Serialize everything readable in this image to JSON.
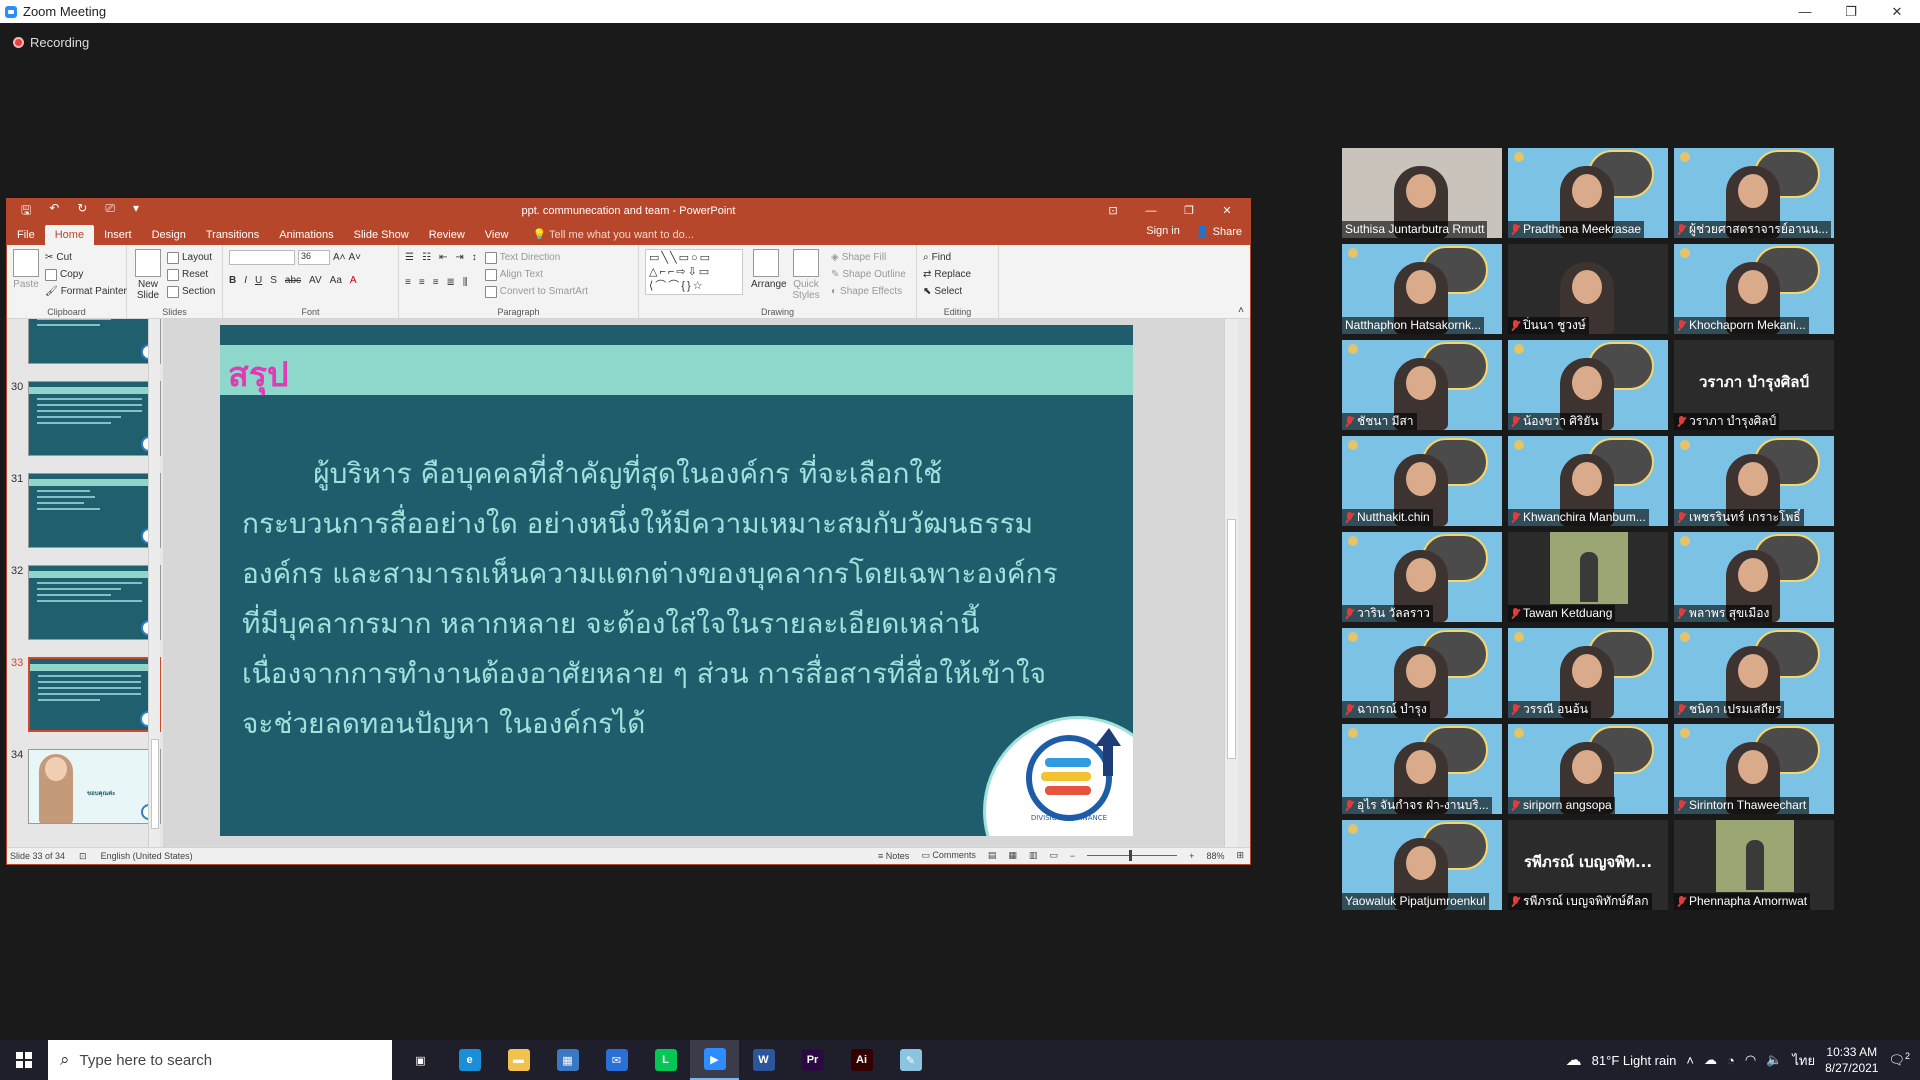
{
  "zoom": {
    "window_title": "Zoom Meeting",
    "recording_label": "Recording",
    "window_controls": [
      "—",
      "❐",
      "✕"
    ]
  },
  "ppt": {
    "doc_title": "ppt. communecation and team - PowerPoint",
    "tabs": [
      "File",
      "Home",
      "Insert",
      "Design",
      "Transitions",
      "Animations",
      "Slide Show",
      "Review",
      "View"
    ],
    "active_tab": "Home",
    "tell_me": "Tell me what you want to do...",
    "sign_in": "Sign in",
    "share": "Share",
    "ribbon": {
      "clipboard": {
        "label": "Clipboard",
        "paste": "Paste",
        "cut": "Cut",
        "copy": "Copy",
        "format_painter": "Format Painter"
      },
      "slides": {
        "label": "Slides",
        "new_slide": "New Slide",
        "layout": "Layout",
        "reset": "Reset",
        "section": "Section"
      },
      "font": {
        "label": "Font",
        "size": "36"
      },
      "paragraph": {
        "label": "Paragraph",
        "text_direction": "Text Direction",
        "align_text": "Align Text",
        "convert_smartart": "Convert to SmartArt"
      },
      "drawing": {
        "label": "Drawing",
        "arrange": "Arrange",
        "quick_styles": "Quick Styles",
        "shape_fill": "Shape Fill",
        "shape_outline": "Shape Outline",
        "shape_effects": "Shape Effects"
      },
      "editing": {
        "label": "Editing",
        "find": "Find",
        "replace": "Replace",
        "select": "Select"
      }
    },
    "thumbnails": [
      {
        "num": "",
        "type": "text"
      },
      {
        "num": "30",
        "type": "text"
      },
      {
        "num": "31",
        "type": "text"
      },
      {
        "num": "32",
        "type": "text"
      },
      {
        "num": "33",
        "type": "text",
        "selected": true
      },
      {
        "num": "34",
        "type": "photo",
        "caption": "ขอบคุณค่ะ"
      }
    ],
    "slide": {
      "title": "สรุป",
      "lines": [
        "        ผู้บริหาร คือบุคคลที่สำคัญที่สุดในองค์กร ที่จะเลือกใช้",
        "กระบวนการสื่ออย่างใด อย่างหนึ่งให้มีความเหมาะสมกับวัฒนธรรม",
        "องค์กร และสามารถเห็นความแตกต่างของบุคลากรโดยเฉพาะองค์กร",
        "ที่มีบุคลากรมาก หลากหลาย จะต้องใส่ใจในรายละเอียดเหล่านี้",
        "เนื่องจากการทำงานต้องอาศัยหลาย ๆ ส่วน การสื่อสารที่สื่อให้เข้าใจ",
        "จะช่วยลดทอนปัญหา ในองค์กรได้"
      ],
      "logo_text": "DIVISION OF FINANCE"
    },
    "status": {
      "slide_of": "Slide 33 of 34",
      "language": "English (United States)",
      "notes": "Notes",
      "comments": "Comments",
      "zoom": "88%"
    }
  },
  "participants": [
    {
      "name": "Suthisa  Juntarbutra Rmutt",
      "muted": false,
      "kind": "speaker"
    },
    {
      "name": "Pradthana Meekrasae",
      "muted": true,
      "kind": "bg"
    },
    {
      "name": "ผู้ช่วยศาสตราจารย์อานน...",
      "muted": true,
      "kind": "bg"
    },
    {
      "name": "Natthaphon Hatsakornk...",
      "muted": false,
      "kind": "bg"
    },
    {
      "name": "ปิ่นนา  ชูวงษ์",
      "muted": true,
      "kind": "dark"
    },
    {
      "name": "Khochaporn Mekani...",
      "muted": true,
      "kind": "bg"
    },
    {
      "name": "ชัชนา  มีสา",
      "muted": true,
      "kind": "bg"
    },
    {
      "name": "น้องขวา  ศิริยัน",
      "muted": true,
      "kind": "bg"
    },
    {
      "name": "วราภา  บำรุงศิลป์",
      "muted": true,
      "kind": "name",
      "big": "วราภา  บำรุงศิลป์"
    },
    {
      "name": "Nutthakit.chin",
      "muted": true,
      "kind": "bg"
    },
    {
      "name": "Khwanchira Manbum...",
      "muted": true,
      "kind": "bg"
    },
    {
      "name": "เพชรรินทร์ เกราะโพธิ์",
      "muted": true,
      "kind": "bg"
    },
    {
      "name": "วาริน  วัลลราว",
      "muted": true,
      "kind": "bg"
    },
    {
      "name": "Tawan Ketduang",
      "muted": true,
      "kind": "photo"
    },
    {
      "name": "พลาพร  สุขเมือง",
      "muted": true,
      "kind": "bg"
    },
    {
      "name": "ฉากรณ์  บำรุง",
      "muted": true,
      "kind": "bg"
    },
    {
      "name": "วรรณี  อนอ้น",
      "muted": true,
      "kind": "bg"
    },
    {
      "name": "ชนิดา  เปรมเสถียร",
      "muted": true,
      "kind": "bg"
    },
    {
      "name": "อุไร  จันกำจร ฝ่า-งานบริ...",
      "muted": true,
      "kind": "bg"
    },
    {
      "name": "siriporn angsopa",
      "muted": true,
      "kind": "bg"
    },
    {
      "name": "Sirintorn Thaweechart",
      "muted": true,
      "kind": "bg"
    },
    {
      "name": "Yaowaluk Pipatjumroenkul",
      "muted": false,
      "kind": "bg"
    },
    {
      "name": "รพีภรณ์ เบญจพิทักษ์ดีลก",
      "muted": true,
      "kind": "name",
      "big": "รพีภรณ์ เบญจพิท..."
    },
    {
      "name": "Phennapha Amornwat",
      "muted": true,
      "kind": "photo"
    }
  ],
  "taskbar": {
    "search_placeholder": "Type here to search",
    "weather": "81°F  Light rain",
    "lang": "ไทย",
    "time": "10:33 AM",
    "date": "8/27/2021",
    "notifications": "2",
    "apps": [
      {
        "name": "task-view",
        "glyph": "▣",
        "color": "#1f1f2b"
      },
      {
        "name": "edge",
        "glyph": "e",
        "color": "#1a8fd8"
      },
      {
        "name": "file-explorer",
        "glyph": "▬",
        "color": "#f2c14e"
      },
      {
        "name": "store",
        "glyph": "▦",
        "color": "#3a78c4"
      },
      {
        "name": "mail",
        "glyph": "✉",
        "color": "#2a6fd6"
      },
      {
        "name": "line",
        "glyph": "L",
        "color": "#06c755"
      },
      {
        "name": "zoom",
        "glyph": "▶",
        "color": "#2d8cff",
        "active": true
      },
      {
        "name": "word",
        "glyph": "W",
        "color": "#2b579a"
      },
      {
        "name": "premiere",
        "glyph": "Pr",
        "color": "#2a0a40"
      },
      {
        "name": "illustrator",
        "glyph": "Ai",
        "color": "#330000"
      },
      {
        "name": "notepad",
        "glyph": "✎",
        "color": "#8bc4e0"
      }
    ]
  }
}
